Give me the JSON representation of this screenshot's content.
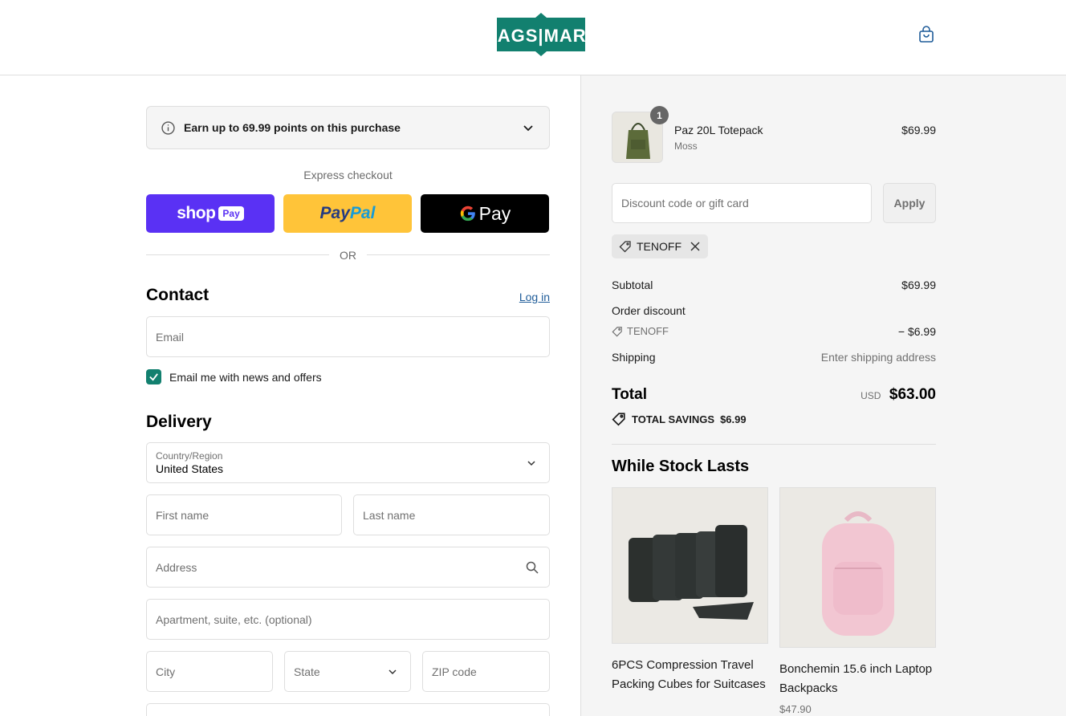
{
  "header": {
    "logo_text": "BAGSMART",
    "cart_icon": "shopping-bag-icon",
    "brand_color": "#12806f"
  },
  "rewards": {
    "text": "Earn up to 69.99 points on this purchase",
    "info_icon": "info-icon",
    "expand_icon": "chevron-down-icon"
  },
  "express": {
    "title": "Express checkout",
    "shop_pay": {
      "word": "shop",
      "badge": "Pay",
      "color": "#5a31f4"
    },
    "paypal": {
      "part1": "Pay",
      "part2": "Pal",
      "color": "#ffc439"
    },
    "gpay": {
      "word": "Pay",
      "color": "#000000"
    },
    "or_text": "OR"
  },
  "contact": {
    "heading": "Contact",
    "login_label": "Log in",
    "email_placeholder": "Email",
    "news_checkbox_label": "Email me with news and offers",
    "news_checked": true
  },
  "delivery": {
    "heading": "Delivery",
    "country_label": "Country/Region",
    "country_value": "United States",
    "first_name_placeholder": "First name",
    "last_name_placeholder": "Last name",
    "address_placeholder": "Address",
    "apartment_placeholder": "Apartment, suite, etc. (optional)",
    "city_placeholder": "City",
    "state_placeholder": "State",
    "zip_placeholder": "ZIP code"
  },
  "order": {
    "item": {
      "quantity": "1",
      "name": "Paz 20L Totepack",
      "variant": "Moss",
      "price": "$69.99"
    },
    "discount_placeholder": "Discount code or gift card",
    "apply_label": "Apply",
    "applied_code": "TENOFF",
    "subtotal_label": "Subtotal",
    "subtotal_value": "$69.99",
    "order_discount_label": "Order discount",
    "order_discount_code": "TENOFF",
    "order_discount_value": "− $6.99",
    "shipping_label": "Shipping",
    "shipping_value": "Enter shipping address",
    "total_label": "Total",
    "total_currency": "USD",
    "total_value": "$63.00",
    "savings_label": "TOTAL SAVINGS",
    "savings_value": "$6.99"
  },
  "upsell": {
    "heading": "While Stock Lasts",
    "items": [
      {
        "title": "6PCS Compression Travel Packing Cubes for Suitcases"
      },
      {
        "title": "Bonchemin 15.6 inch Laptop Backpacks",
        "price": "$47.90"
      }
    ]
  }
}
